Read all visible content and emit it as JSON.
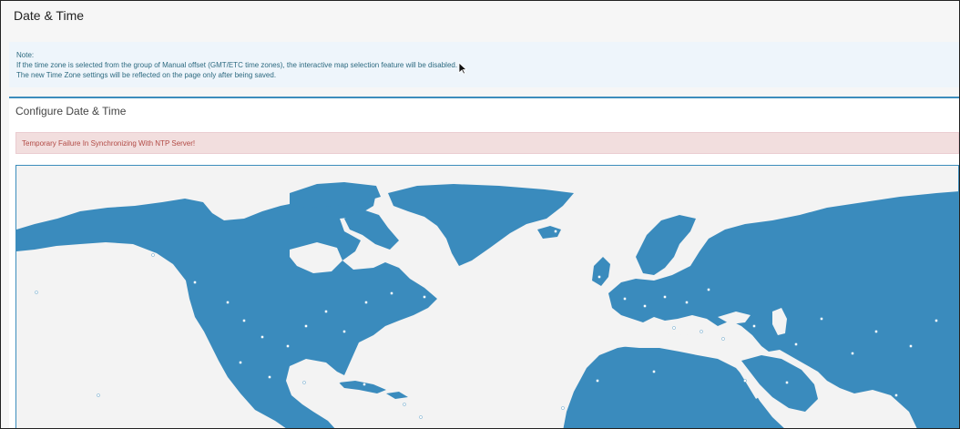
{
  "page": {
    "title": "Date & Time"
  },
  "note": {
    "heading": "Note:",
    "line1": "If the time zone is selected from the group of Manual offset (GMT/ETC time zones), the interactive map selection feature will be disabled.",
    "line2": "The new Time Zone settings will be reflected on the page only after being saved."
  },
  "configure": {
    "title": "Configure Date & Time",
    "alert": "Temporary Failure In Synchronizing With NTP Server!"
  },
  "map": {
    "land_color": "#3a8bbd",
    "ocean_color": "#f3f3f3",
    "city_marker_color": "#ffffff"
  }
}
